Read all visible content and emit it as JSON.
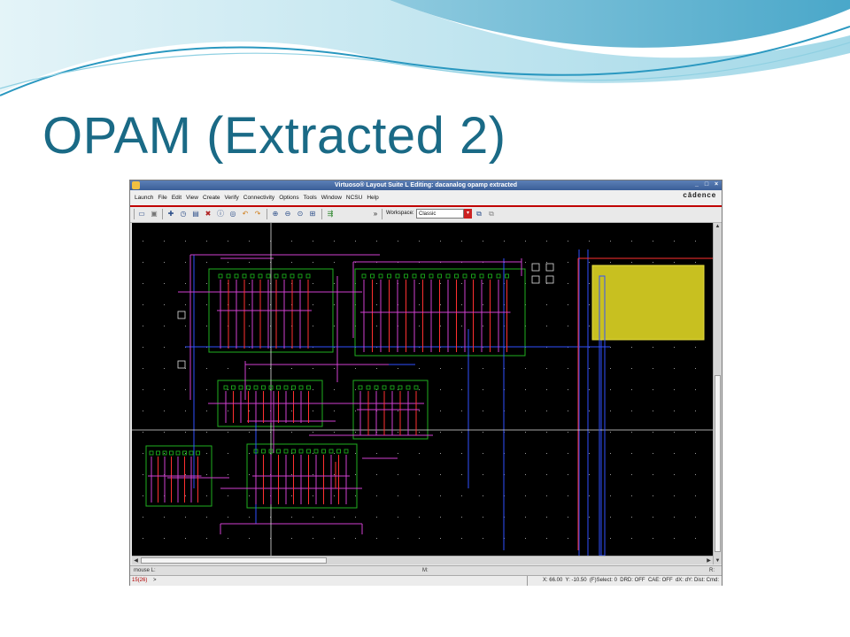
{
  "slide": {
    "title": "OPAM (Extracted 2)"
  },
  "window": {
    "title": "Virtuoso® Layout Suite L Editing: dacanalog opamp extracted",
    "controls": [
      "_",
      "□",
      "×"
    ]
  },
  "menu": [
    "Launch",
    "File",
    "Edit",
    "View",
    "Create",
    "Verify",
    "Connectivity",
    "Options",
    "Tools",
    "Window",
    "NCSU",
    "Help"
  ],
  "brand": "cādence",
  "toolbar": {
    "workspace_label": "Workspace:",
    "workspace_value": "Classic"
  },
  "mouse_bar": {
    "left": "mouse L:",
    "middle": "M:",
    "right": "R:"
  },
  "status": {
    "count": "15(26)",
    "prompt": ">",
    "x": "X: 66.00",
    "y": "Y: -10.50",
    "select": "(F)Select: 0",
    "drd": "DRD: OFF",
    "cae": "CAE: OFF",
    "dxdy": "dX: dY: Dist: Cmd:"
  },
  "colors": {
    "title": "#1a6a86",
    "canvas": "#000000",
    "metal": "#d040d0",
    "poly": "#ff3030",
    "diffusion": "#20c020",
    "via": "#3050ff",
    "pad": "#c8c020"
  }
}
